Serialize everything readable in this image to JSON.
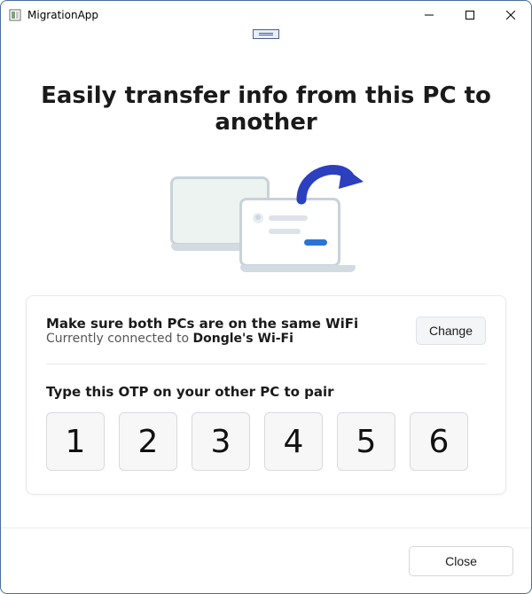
{
  "window": {
    "title": "MigrationApp"
  },
  "headline": "Easily transfer info from this PC to another",
  "wifi": {
    "title": "Make sure both PCs are on the same WiFi",
    "sub_prefix": "Currently connected to ",
    "network": "Dongle's Wi-Fi",
    "change_label": "Change"
  },
  "otp": {
    "title": "Type this OTP on your other PC to pair",
    "digits": [
      "1",
      "2",
      "3",
      "4",
      "5",
      "6"
    ]
  },
  "footer": {
    "close_label": "Close"
  }
}
